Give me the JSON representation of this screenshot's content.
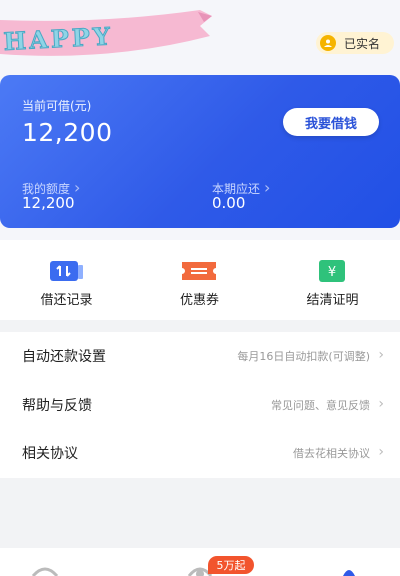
{
  "header": {
    "banner_text": "HAPPY",
    "verification_badge": "已实名"
  },
  "loan_card": {
    "available_label": "当前可借(元)",
    "available_amount": "12,200",
    "borrow_button": "我要借钱",
    "quota_label": "我的额度",
    "quota_value": "12,200",
    "due_label": "本期应还",
    "due_value": "0.00"
  },
  "quick_actions": [
    {
      "label": "借还记录",
      "icon": "transaction-record-icon",
      "color": "#3b6cf0"
    },
    {
      "label": "优惠券",
      "icon": "coupon-icon",
      "color": "#f26a3d"
    },
    {
      "label": "结清证明",
      "icon": "settlement-certificate-icon",
      "color": "#2fc27b"
    }
  ],
  "settings": [
    {
      "label": "自动还款设置",
      "detail": "每月16日自动扣款(可调整)"
    },
    {
      "label": "帮助与反馈",
      "detail": "常见问题、意见反馈"
    },
    {
      "label": "相关协议",
      "detail": "借去花相关协议"
    }
  ],
  "tabbar": {
    "promo_badge": "5万起"
  },
  "colors": {
    "brand_blue": "#2f5ae8",
    "badge_yellow": "#f5b400",
    "promo_red": "#f2542d"
  }
}
